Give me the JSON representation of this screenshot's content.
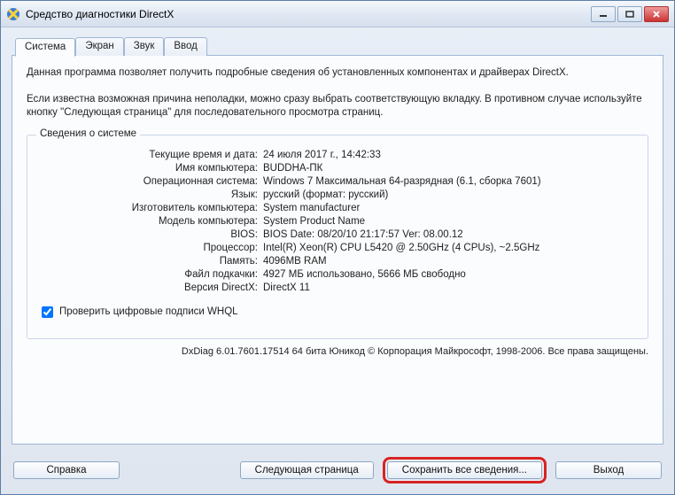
{
  "window": {
    "title": "Средство диагностики DirectX"
  },
  "tabs": {
    "system": "Система",
    "display": "Экран",
    "sound": "Звук",
    "input": "Ввод"
  },
  "intro": {
    "p1": "Данная программа позволяет получить подробные сведения об установленных компонентах и драйверах DirectX.",
    "p2": "Если известна возможная причина неполадки, можно сразу выбрать соответствующую вкладку. В противном случае используйте кнопку \"Следующая страница\" для последовательного просмотра страниц."
  },
  "sysinfo": {
    "legend": "Сведения о системе",
    "rows": {
      "datetime_label": "Текущие время и дата:",
      "datetime_value": "24 июля 2017 г., 14:42:33",
      "computer_label": "Имя компьютера:",
      "computer_value": "BUDDHA-ПК",
      "os_label": "Операционная система:",
      "os_value": "Windows 7 Максимальная 64-разрядная (6.1, сборка 7601)",
      "lang_label": "Язык:",
      "lang_value": "русский (формат: русский)",
      "manuf_label": "Изготовитель компьютера:",
      "manuf_value": "System manufacturer",
      "model_label": "Модель компьютера:",
      "model_value": "System Product Name",
      "bios_label": "BIOS:",
      "bios_value": "BIOS Date: 08/20/10 21:17:57 Ver: 08.00.12",
      "cpu_label": "Процессор:",
      "cpu_value": "Intel(R) Xeon(R) CPU           L5420  @ 2.50GHz (4 CPUs), ~2.5GHz",
      "mem_label": "Память:",
      "mem_value": "4096MB RAM",
      "page_label": "Файл подкачки:",
      "page_value": "4927 МБ использовано, 5666 МБ свободно",
      "dx_label": "Версия DirectX:",
      "dx_value": "DirectX 11"
    }
  },
  "checkbox": {
    "label": "Проверить цифровые подписи WHQL"
  },
  "footer": "DxDiag 6.01.7601.17514 64 бита Юникод   © Корпорация Майкрософт, 1998-2006.   Все права защищены.",
  "buttons": {
    "help": "Справка",
    "next": "Следующая страница",
    "save": "Сохранить все сведения...",
    "exit": "Выход"
  }
}
